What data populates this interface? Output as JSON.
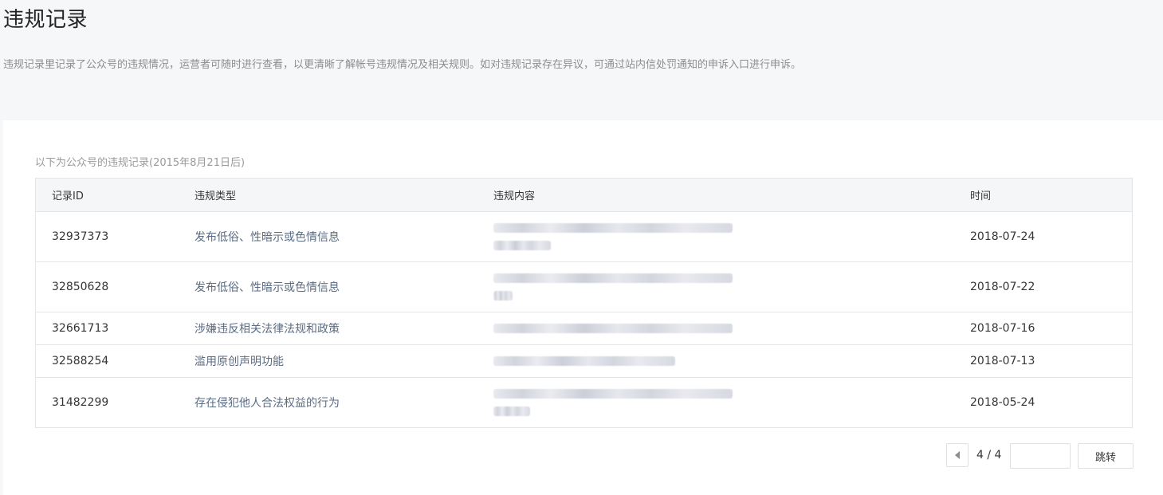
{
  "page": {
    "title": "违规记录",
    "description": "违规记录里记录了公众号的违规情况，运营者可随时进行查看，以更清晰了解帐号违规情况及相关规则。如对违规记录存在异议，可通过站内信处罚通知的申诉入口进行申诉。"
  },
  "records": {
    "subtitle": "以下为公众号的违规记录(2015年8月21日后)",
    "columns": [
      "记录ID",
      "违规类型",
      "违规内容",
      "时间"
    ],
    "rows": [
      {
        "id": "32937373",
        "type": "发布低俗、性暗示或色情信息",
        "date": "2018-07-24"
      },
      {
        "id": "32850628",
        "type": "发布低俗、性暗示或色情信息",
        "date": "2018-07-22"
      },
      {
        "id": "32661713",
        "type": "涉嫌违反相关法律法规和政策",
        "date": "2018-07-16"
      },
      {
        "id": "32588254",
        "type": "滥用原创声明功能",
        "date": "2018-07-13"
      },
      {
        "id": "31482299",
        "type": "存在侵犯他人合法权益的行为",
        "date": "2018-05-24"
      }
    ]
  },
  "pagination": {
    "page_text": "4 / 4",
    "input_value": "",
    "jump_label": "跳转",
    "prev_icon": "caret-left-icon"
  }
}
